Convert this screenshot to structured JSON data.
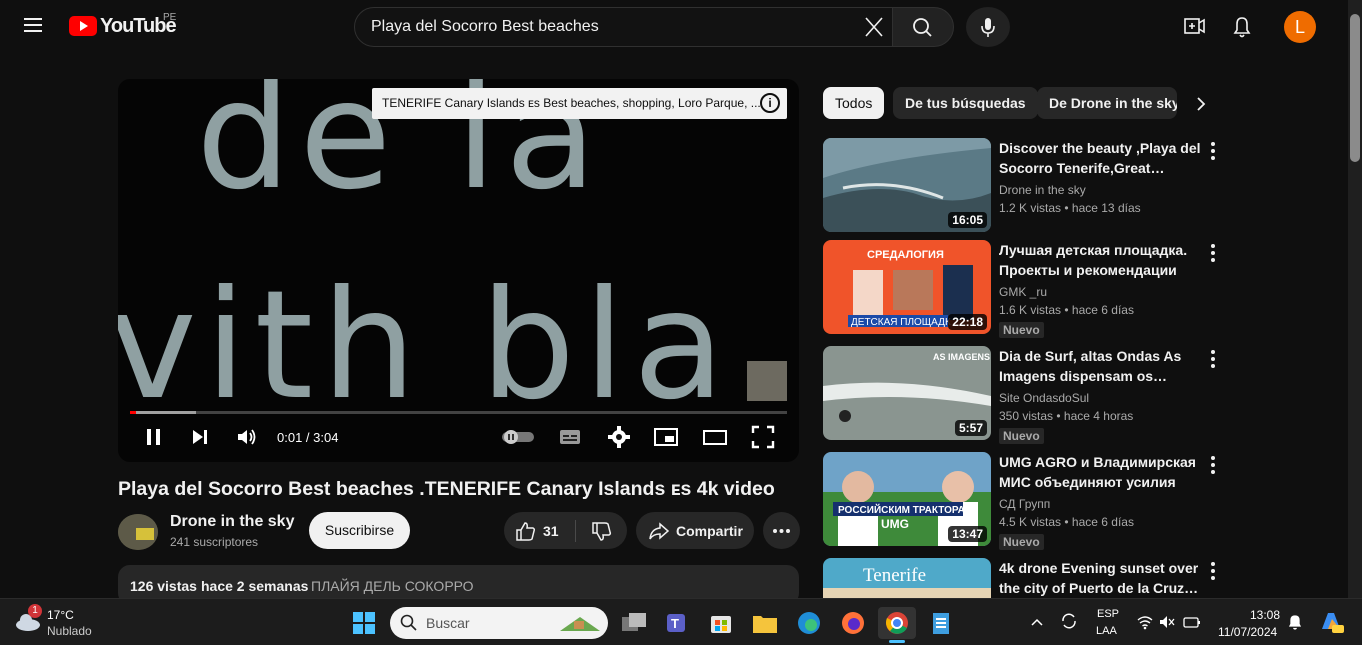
{
  "header": {
    "logo_text": "YouTube",
    "country_code": "PE",
    "search_value": "Playa del Socorro Best beaches",
    "avatar_letter": "L"
  },
  "player": {
    "overlay_text_top": "de la",
    "overlay_text_bottom": "vith bla",
    "card_tip": "TENERIFE Canary Islands ᴇs Best beaches, shopping, Loro Parque, ...",
    "time": "0:01 / 3:04",
    "progress_played": 0.003,
    "progress_buffered": 0.1
  },
  "video": {
    "title": "Playa del Socorro Best beaches .TENERIFE Canary Islands ᴇs 4k video",
    "channel": "Drone in the sky",
    "subscribers": "241 suscriptores",
    "subscribe_label": "Suscribirse",
    "likes": "31",
    "share_label": "Compartir",
    "views": "126 vistas",
    "age": "hace 2 semanas",
    "tag": "ПЛАЙЯ ДЕЛЬ СОКОРРО"
  },
  "chips": [
    "Todos",
    "De tus búsquedas",
    "De Drone in the sky"
  ],
  "recommendations": [
    {
      "title": "Discover the beauty ,Playa del Socorro Tenerife,Great…",
      "channel": "Drone in the sky",
      "views": "1.2 K vistas",
      "age": "hace 13 días",
      "duration": "16:05",
      "badge": "",
      "thumb_color": "#5b7a86"
    },
    {
      "title": "Лучшая детская площадка. Проекты и рекомендации по…",
      "channel": "GMK _ru",
      "views": "1.6 K vistas",
      "age": "hace 6 días",
      "duration": "22:18",
      "badge": "Nuevo",
      "thumb_color": "#f0542a"
    },
    {
      "title": "Dia de Surf, altas Ondas As Imagens dispensam os…",
      "channel": "Site OndasdoSul",
      "views": "350 vistas",
      "age": "hace 4 horas",
      "duration": "5:57",
      "badge": "Nuevo",
      "thumb_color": "#8a9590"
    },
    {
      "title": "UMG AGRO и Владимирская МИС объединяют усилия дл…",
      "channel": "СД Групп",
      "views": "4.5 K vistas",
      "age": "hace 6 días",
      "duration": "13:47",
      "badge": "Nuevo",
      "thumb_color": "#3e8a3a"
    },
    {
      "title": "4k drone Evening sunset over the city of Puerto de la Cruz…",
      "channel": "",
      "views": "",
      "age": "",
      "duration": "",
      "badge": "",
      "thumb_color": "#4fa9c9"
    }
  ],
  "thumb_texts": {
    "r2_top": "СРЕДАЛОГИЯ",
    "r2_bottom": "ДЕТСКАЯ ПЛОЩАДК",
    "r3_top": "AS IMAGENS",
    "r4_bottom1": "РОССИЙСКИМ ТРАКТОРАМ",
    "r4_bottom2": "UMG",
    "r5_top": "Tenerife"
  },
  "taskbar": {
    "weather_badge": "1",
    "temp": "17°C",
    "condition": "Nublado",
    "search_placeholder": "Buscar",
    "lang1": "ESP",
    "lang2": "LAA",
    "time": "13:08",
    "date": "11/07/2024"
  }
}
